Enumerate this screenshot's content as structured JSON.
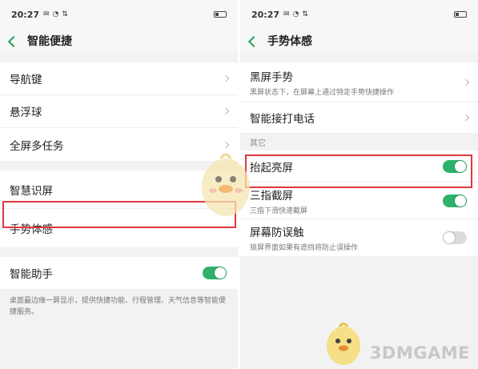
{
  "left": {
    "status": {
      "time": "20:27",
      "icons": [
        "message-icon",
        "wifi-icon",
        "data-speed-icon"
      ]
    },
    "title": "智能便捷",
    "items": [
      {
        "label": "导航键"
      },
      {
        "label": "悬浮球"
      },
      {
        "label": "全屏多任务"
      }
    ],
    "item_smart_screen": "智慧识屏",
    "item_gesture": "手势体感",
    "assistant": {
      "label": "智能助手",
      "toggle": "on"
    },
    "note": "桌面最边缘一屏显示，提供快捷功能、行程管理、天气信息等智能便捷服务。"
  },
  "right": {
    "status": {
      "time": "20:27",
      "icons": [
        "message-icon",
        "wifi-icon",
        "data-speed-icon"
      ]
    },
    "title": "手势体感",
    "black_screen": {
      "label": "黑屏手势",
      "sub": "黑屏状态下，在屏幕上通过特定手势快捷操作"
    },
    "smart_call": {
      "label": "智能接打电话"
    },
    "section_other": "其它",
    "raise_wake": {
      "label": "抬起亮屏",
      "toggle": "on"
    },
    "three_finger": {
      "label": "三指截屏",
      "sub": "三指下滑快速截屏",
      "toggle": "on"
    },
    "anti_touch": {
      "label": "屏幕防误触",
      "sub": "锁屏界面如果有遮挡将防止误操作",
      "toggle": "off"
    }
  },
  "colors": {
    "accent": "#2eb26b",
    "highlight": "#e0383e"
  },
  "watermark": "3DMGAME"
}
